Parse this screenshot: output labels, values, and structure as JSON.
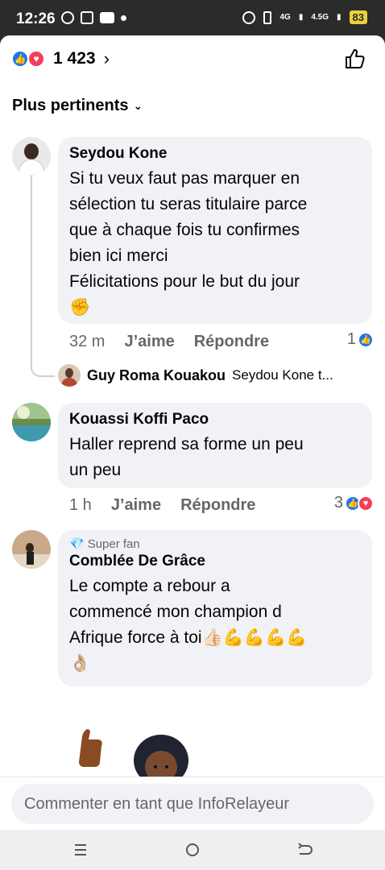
{
  "status": {
    "time": "12:26",
    "network1": "4G",
    "network2": "4.5G",
    "battery": "83"
  },
  "header": {
    "reaction_count": "1 423",
    "chevron": "›"
  },
  "sort": {
    "label": "Plus pertinents",
    "chevron": "⌄"
  },
  "comments": [
    {
      "author": "Seydou Kone",
      "text": "Si tu veux faut pas marquer en\nsélection tu seras titulaire parce\nque à chaque fois tu confirmes\nbien ici merci\nFélicitations pour le but du jour\n✊",
      "time": "32 m",
      "like_label": "J’aime",
      "reply_label": "Répondre",
      "reaction_count": "1",
      "reply_preview": {
        "author": "Guy Roma Kouakou",
        "text": "Seydou Kone t..."
      }
    },
    {
      "author": "Kouassi Koffi Paco",
      "text": "Haller reprend sa forme un peu\nun peu",
      "time": "1 h",
      "like_label": "J’aime",
      "reply_label": "Répondre",
      "reaction_count": "3"
    },
    {
      "badge": "Super fan",
      "author": "Comblée De Grâce",
      "text": "Le compte a rebour a\ncommencé mon champion d\nAfrique force à toi👍🏻💪💪💪💪\n👌🏼"
    }
  ],
  "composer": {
    "placeholder": "Commenter en tant que InfoRelayeur"
  },
  "colors": {
    "like_blue": "#1877f2",
    "love_red": "#f33e58",
    "bubble_bg": "#f0f2f5",
    "meta_gray": "#65676b"
  },
  "icons": [
    "like-reaction-icon",
    "love-reaction-icon",
    "thumbs-up-outline-icon",
    "chevron-down-icon",
    "menu-icon",
    "home-circle-icon",
    "back-icon"
  ]
}
